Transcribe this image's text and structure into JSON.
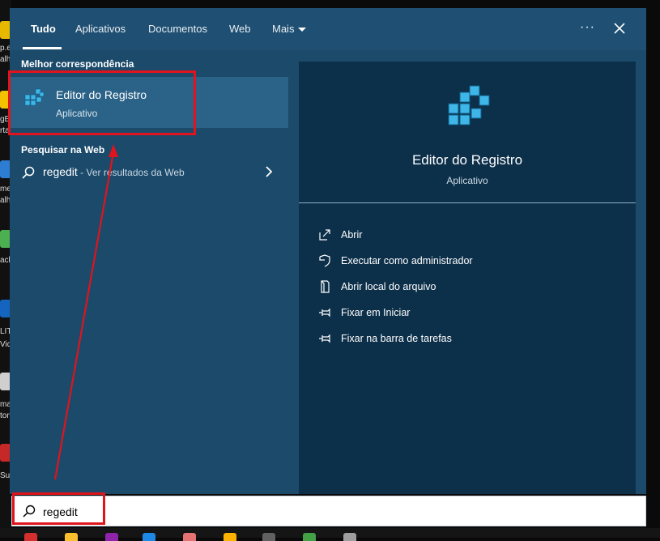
{
  "tabs": [
    {
      "label": "Tudo",
      "active": true
    },
    {
      "label": "Aplicativos"
    },
    {
      "label": "Documentos"
    },
    {
      "label": "Web"
    },
    {
      "label": "Mais"
    }
  ],
  "window": {
    "more_options_icon": "ellipsis-icon",
    "close_icon": "close-icon"
  },
  "sections": {
    "best_match": "Melhor correspondência",
    "web_search": "Pesquisar na Web"
  },
  "best_match": {
    "title": "Editor do Registro",
    "subtitle": "Aplicativo",
    "icon": "registry-editor-icon"
  },
  "web_result": {
    "query": "regedit",
    "hint": " - Ver resultados da Web"
  },
  "preview": {
    "title": "Editor do Registro",
    "subtitle": "Aplicativo",
    "actions": [
      {
        "label": "Abrir",
        "icon": "open-icon"
      },
      {
        "label": "Executar como administrador",
        "icon": "shield-icon"
      },
      {
        "label": "Abrir local do arquivo",
        "icon": "file-location-icon"
      },
      {
        "label": "Fixar em Iniciar",
        "icon": "pin-icon"
      },
      {
        "label": "Fixar na barra de tarefas",
        "icon": "pin-icon"
      }
    ]
  },
  "search": {
    "value": "regedit",
    "icon": "search-icon"
  },
  "desktop_fragments": [
    "p.e",
    "alh",
    "gE",
    "rta",
    "mer",
    "alh",
    "ack",
    "LIT",
    "Vid",
    "ma",
    "ton",
    "Su"
  ],
  "colors": {
    "accent_panel": "#1b4a6b",
    "preview_bg": "#0c2f4a",
    "selected": "#2b6388",
    "annotation": "#e0141c"
  }
}
